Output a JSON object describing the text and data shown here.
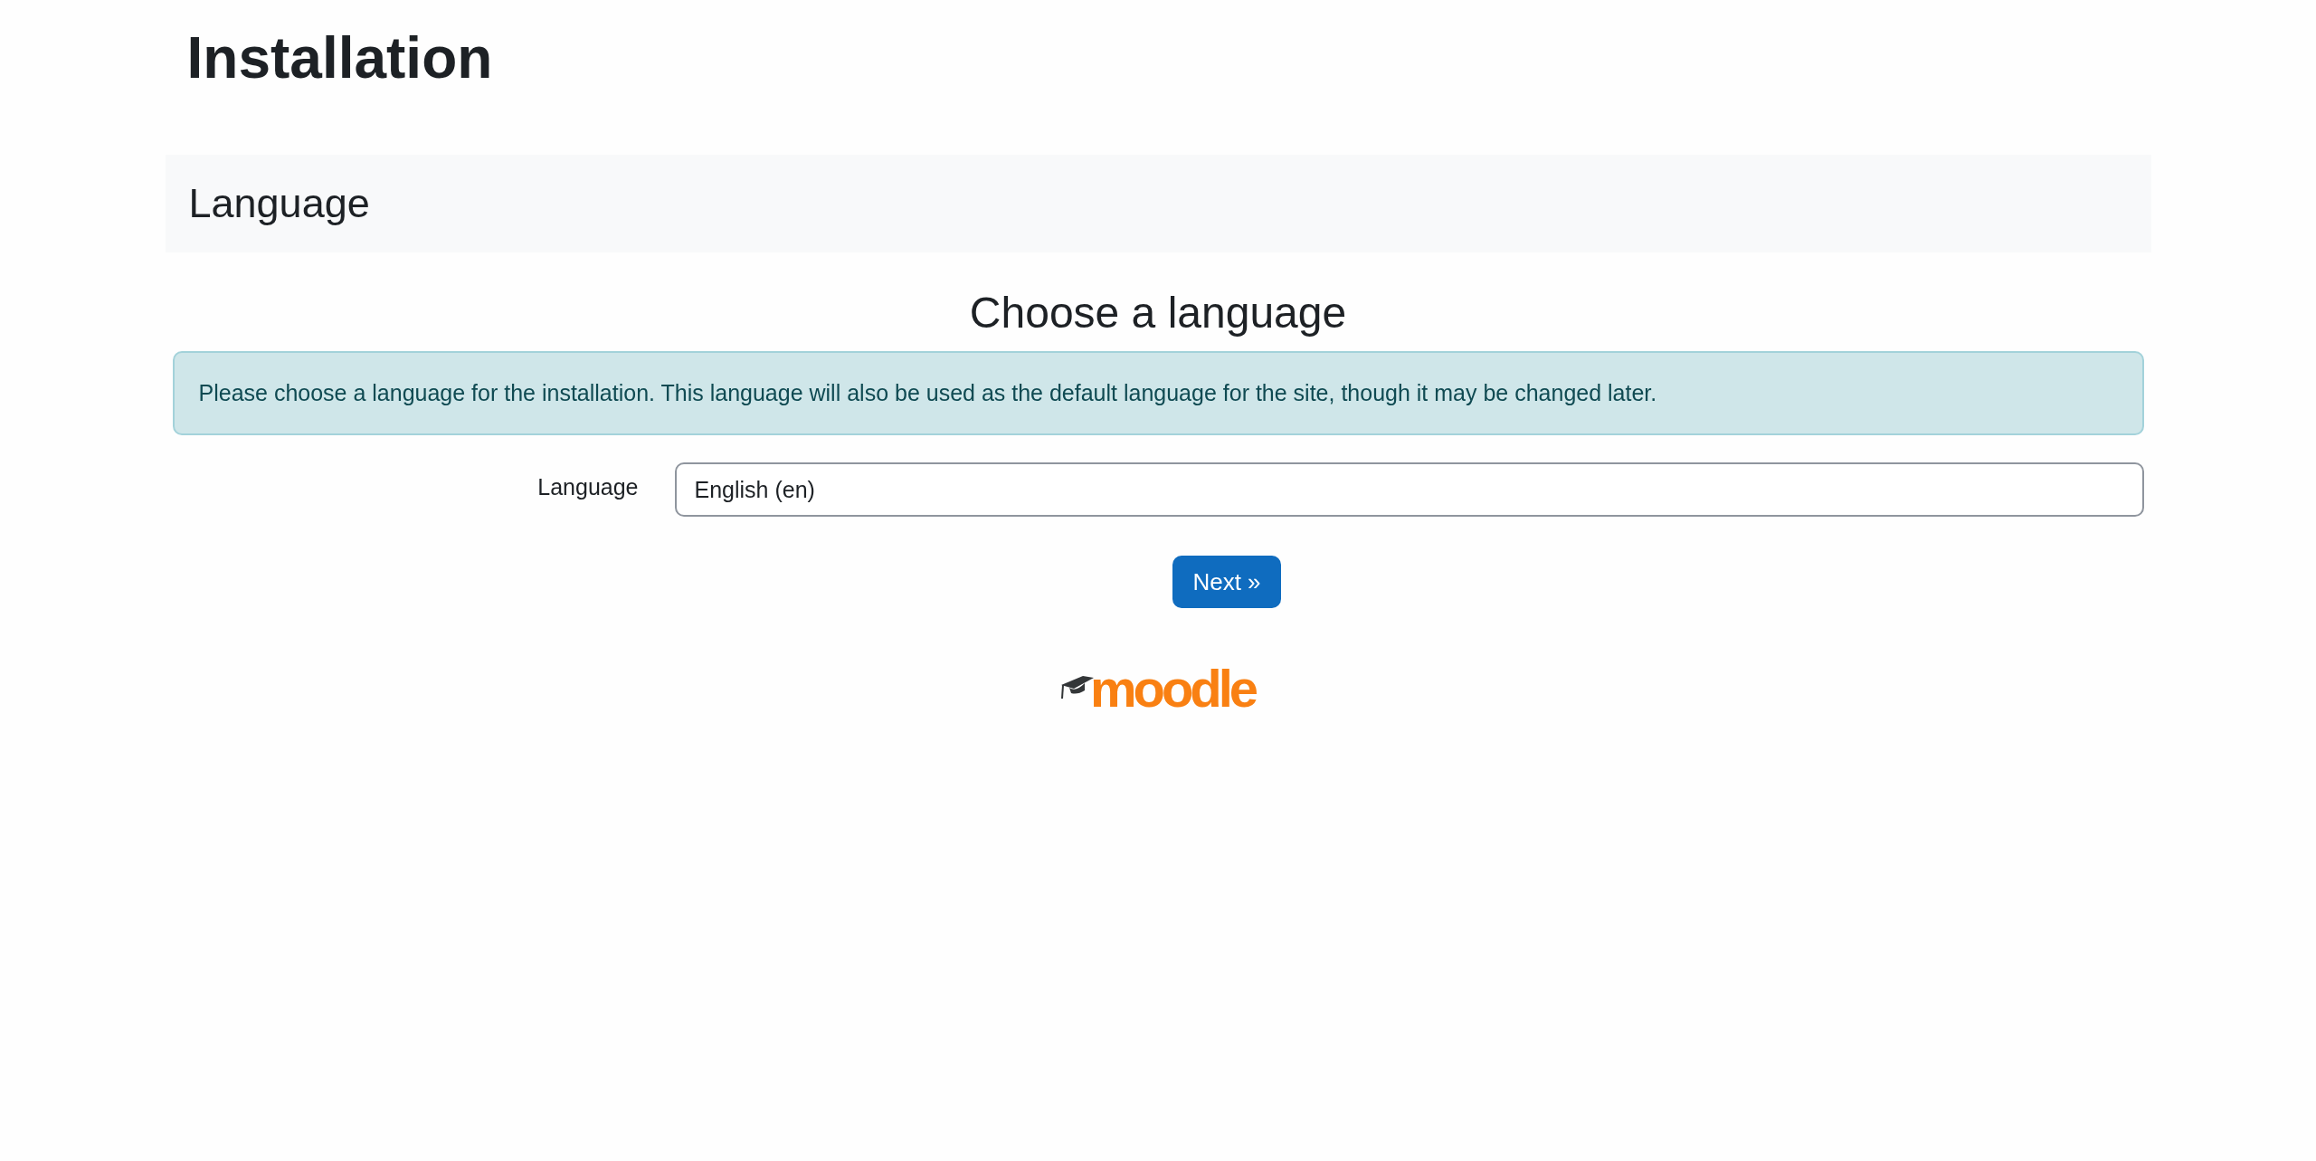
{
  "page": {
    "title": "Installation"
  },
  "section": {
    "title": "Language"
  },
  "heading": "Choose a language",
  "notice": "Please choose a language for the installation. This language will also be used as the default language for the site, though it may be changed later.",
  "form": {
    "fields": [
      {
        "label": "Language",
        "value": "English (en)"
      }
    ]
  },
  "buttons": [
    {
      "label": "Next »"
    }
  ],
  "footer": {
    "logo": {
      "text": "moodle"
    }
  }
}
